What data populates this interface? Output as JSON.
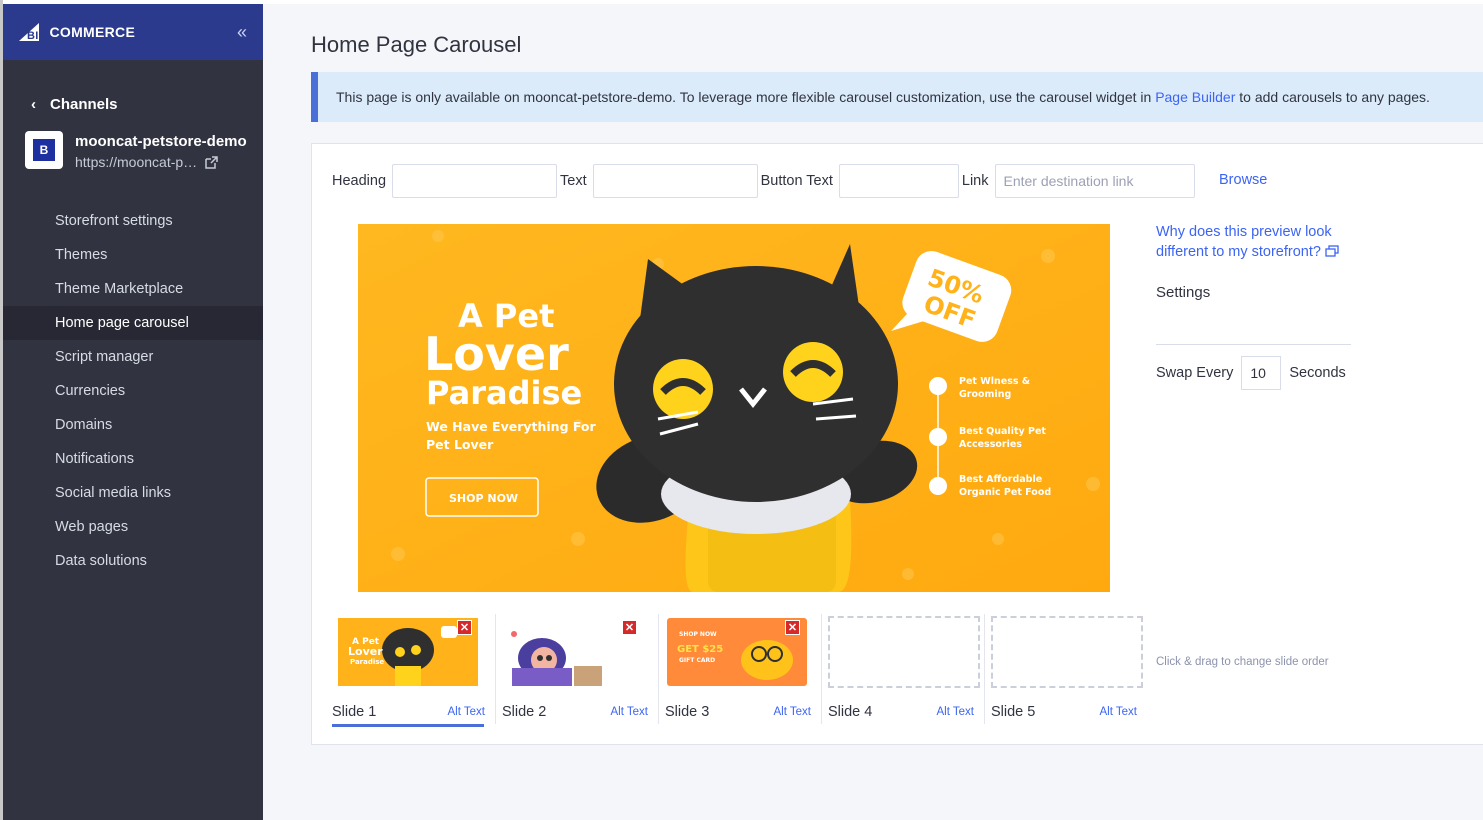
{
  "sidebar": {
    "brand": "COMMERCE",
    "brand_prefix": "BIG",
    "back_label": "Channels",
    "store_name": "mooncat-petstore-demo",
    "store_url": "https://mooncat-p…",
    "items": [
      {
        "label": "Storefront settings"
      },
      {
        "label": "Themes"
      },
      {
        "label": "Theme Marketplace"
      },
      {
        "label": "Home page carousel"
      },
      {
        "label": "Script manager"
      },
      {
        "label": "Currencies"
      },
      {
        "label": "Domains"
      },
      {
        "label": "Notifications"
      },
      {
        "label": "Social media links"
      },
      {
        "label": "Web pages"
      },
      {
        "label": "Data solutions"
      }
    ],
    "active_item": "Home page carousel"
  },
  "page": {
    "title": "Home Page Carousel",
    "banner_text": "This page is only available on mooncat-petstore-demo. To leverage more flexible carousel customization, use the carousel widget in",
    "banner_link": "Page Builder",
    "banner_suffix": "to add carousels to any pages."
  },
  "form": {
    "heading_label": "Heading",
    "heading_value": "",
    "text_label": "Text",
    "text_value": "",
    "button_text_label": "Button Text",
    "button_text_value": "",
    "link_label": "Link",
    "link_placeholder": "Enter destination link",
    "browse_label": "Browse"
  },
  "preview": {
    "headline_line1": "A Pet",
    "headline_line2": "Lover",
    "headline_line3": "Paradise",
    "subheadline": "We Have Everything For Pet Lover",
    "cta": "SHOP NOW",
    "badge": "50% OFF",
    "features": [
      "Pet Wlness & Grooming",
      "Best Quality Pet Accessories",
      "Best Affordable Organic Pet Food"
    ]
  },
  "side": {
    "why_link": "Why does this preview look different to my storefront?",
    "settings_label": "Settings",
    "swap_prefix": "Swap Every",
    "swap_value": "10",
    "swap_suffix": "Seconds",
    "drag_hint": "Click & drag to change slide order"
  },
  "slides": [
    {
      "label": "Slide 1",
      "alt": "Alt Text",
      "has_image": true,
      "active": true
    },
    {
      "label": "Slide 2",
      "alt": "Alt Text",
      "has_image": true,
      "active": false
    },
    {
      "label": "Slide 3",
      "alt": "Alt Text",
      "has_image": true,
      "active": false
    },
    {
      "label": "Slide 4",
      "alt": "Alt Text",
      "has_image": false,
      "active": false
    },
    {
      "label": "Slide 5",
      "alt": "Alt Text",
      "has_image": false,
      "active": false
    }
  ],
  "colors": {
    "sidebar_bg": "#313440",
    "sidebar_header": "#2b3a8c",
    "accent": "#3c64f4",
    "banner_orange": "#ffb21a",
    "remove_red": "#d62a2a"
  }
}
